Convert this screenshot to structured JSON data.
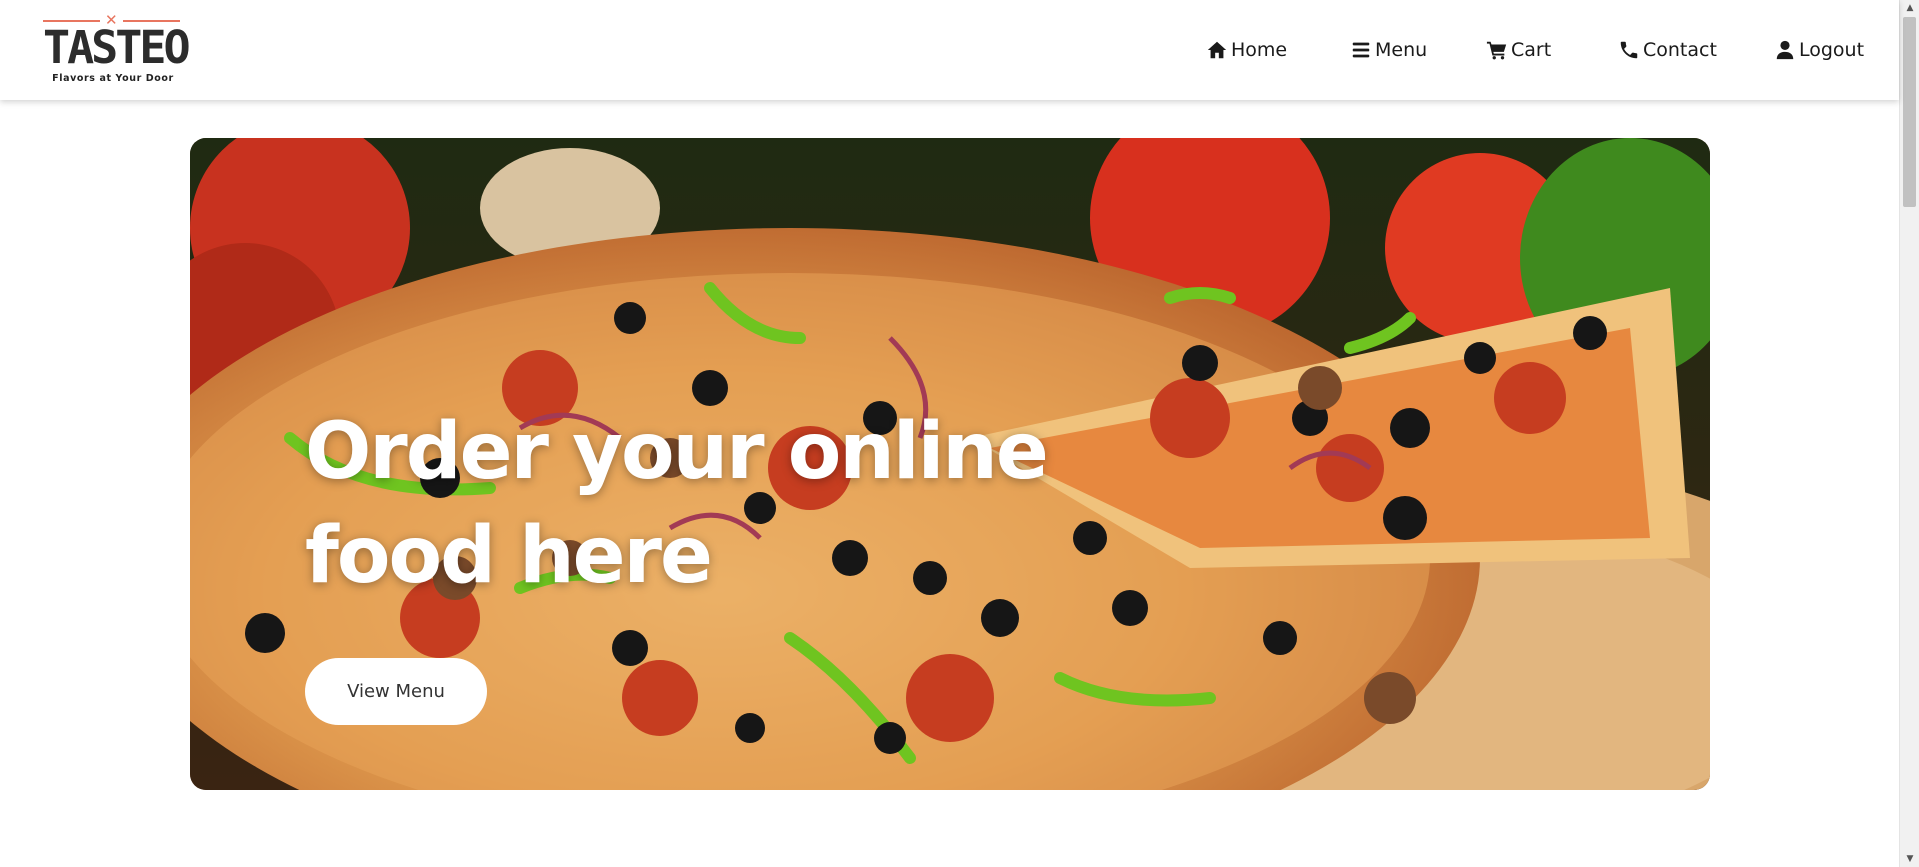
{
  "brand": {
    "name": "TASTEO",
    "tagline": "Flavors at Your Door",
    "accent_color": "#e8755f",
    "text_color": "#2c2c2c"
  },
  "nav": {
    "items": [
      {
        "label": "Home",
        "icon": "home-icon"
      },
      {
        "label": "Menu",
        "icon": "menu-icon"
      },
      {
        "label": "Cart",
        "icon": "cart-icon"
      },
      {
        "label": "Contact",
        "icon": "phone-icon"
      },
      {
        "label": "Logout",
        "icon": "user-icon"
      }
    ]
  },
  "hero": {
    "title_line1": "Order your online",
    "title_line2": "food here",
    "button_label": "View Menu",
    "image": "pizza-photo"
  }
}
